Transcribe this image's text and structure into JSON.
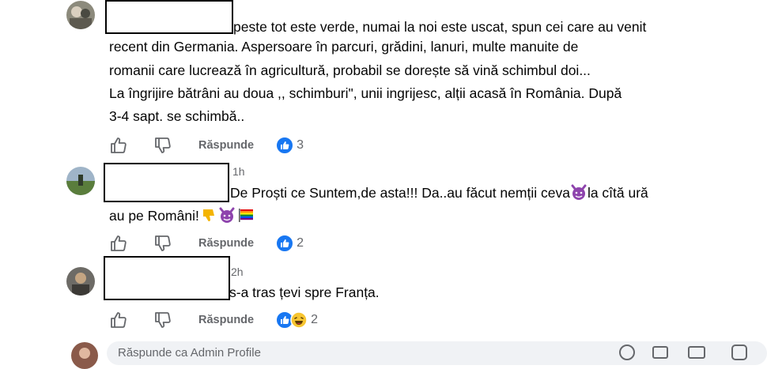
{
  "comments": [
    {
      "time": "",
      "lines": [
        "peste tot este verde, numai la noi este uscat, spun cei care au venit",
        "recent din Germania. Aspersoare în parcuri, grădini, lanuri, multe manuite de",
        "romanii care lucrează în agricultură, probabil se dorește să vină schimbul doi...",
        "La îngrijire bătrâni au doua ,, schimburi\", unii ingrijesc, alții acasă în România. După",
        "3-4 sapt. se schimbă.."
      ],
      "reply_label": "Răspunde",
      "reaction_count": "3"
    },
    {
      "time": "1h",
      "line1_a": "De Proști ce Suntem,de asta!!! Da..au făcut nemții ceva",
      "line1_b": "la cîtă ură",
      "line2": "au pe Români!",
      "reply_label": "Răspunde",
      "reaction_count": "2"
    },
    {
      "time": "2h",
      "line1": "s-a tras țevi spre Franța.",
      "reply_label": "Răspunde",
      "reaction_count": "2"
    }
  ],
  "composer": {
    "placeholder": "Răspunde ca Admin Profile"
  },
  "colors": {
    "like_blue": "#1877f2",
    "secondary_text": "#65676b"
  },
  "icons": [
    "like-outline-icon",
    "dislike-outline-icon",
    "like-reaction-icon",
    "laugh-reaction-icon",
    "devil-emoji-icon",
    "thumbs-down-emoji-icon",
    "rainbow-flag-emoji-icon"
  ]
}
